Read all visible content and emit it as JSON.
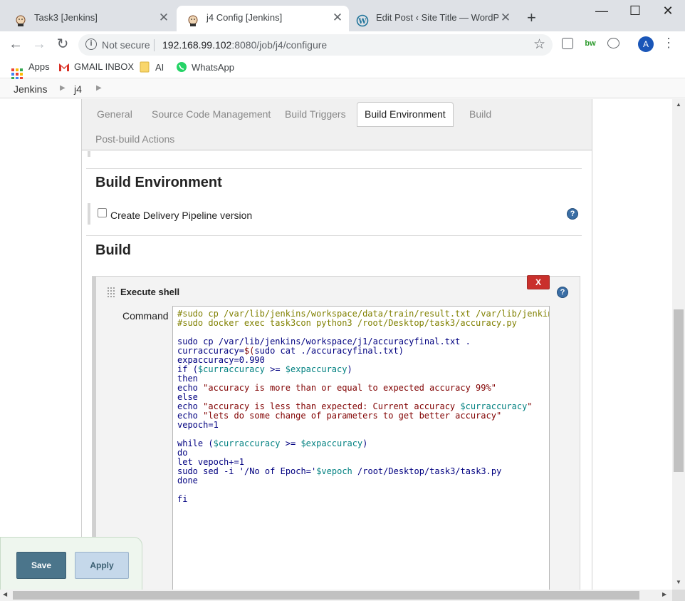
{
  "browser": {
    "tabs": [
      {
        "title": "Task3 [Jenkins]",
        "active": false
      },
      {
        "title": "j4 Config [Jenkins]",
        "active": true
      },
      {
        "title": "Edit Post ‹ Site Title — WordPres",
        "active": false
      }
    ],
    "close_glyph": "✕",
    "new_tab_glyph": "+",
    "window_controls": {
      "minimize": "—",
      "maximize": "☐",
      "close": "✕"
    },
    "security_label": "Not secure",
    "url_host": "192.168.99.102",
    "url_rest": ":8080/job/j4/configure",
    "profile_initial": "A",
    "extensions": [
      "bw"
    ],
    "bookmarks": [
      {
        "label": "Apps",
        "icon": "apps-grid-icon"
      },
      {
        "label": "GMAIL INBOX",
        "icon": "gmail-icon"
      },
      {
        "label": "AI",
        "icon": "folder-icon"
      },
      {
        "label": "WhatsApp",
        "icon": "whatsapp-icon"
      }
    ]
  },
  "breadcrumbs": [
    "Jenkins",
    "j4"
  ],
  "config_tabs": [
    {
      "label": "General",
      "active": false
    },
    {
      "label": "Source Code Management",
      "active": false
    },
    {
      "label": "Build Triggers",
      "active": false
    },
    {
      "label": "Build Environment",
      "active": true
    },
    {
      "label": "Build",
      "active": false
    },
    {
      "label": "Post-build Actions",
      "active": false
    }
  ],
  "build_environment": {
    "title": "Build Environment",
    "option_label": "Create Delivery Pipeline version",
    "option_checked": false
  },
  "build": {
    "title": "Build",
    "step": {
      "title": "Execute shell",
      "delete_label": "X",
      "command_label": "Command",
      "script_lines": [
        "#sudo cp /var/lib/jenkins/workspace/data/train/result.txt /var/lib/jenkin",
        "#sudo docker exec task3con python3 /root/Desktop/task3/accuracy.py",
        "",
        "sudo cp /var/lib/jenkins/workspace/j1/accuracyfinal.txt .",
        "curraccuracy=$(sudo cat ./accuracyfinal.txt)",
        "expaccuracy=0.990",
        "if ($curraccuracy >= $expaccuracy)",
        "then",
        "echo \"accuracy is more than or equal to expected accuracy 99%\"",
        "else",
        "echo \"accuracy is less than expected: Current accuracy $curraccuracy\"",
        "echo \"lets do some change of parameters to get better accuracy\"",
        "vepoch=1",
        "",
        "while ($curraccuracy >= $expaccuracy)",
        "do",
        "let vepoch+=1",
        "sudo sed -i '/No of Epoch='$vepoch /root/Desktop/task3/task3.py",
        "done",
        "",
        "fi"
      ]
    }
  },
  "actions": {
    "save_label": "Save",
    "apply_label": "Apply"
  },
  "help_glyph": "?",
  "colors": {
    "accent": "#4b758b",
    "delete": "#c9302c",
    "help": "#3a6ea5",
    "shell_keyword": "#000080",
    "shell_string": "#800000",
    "shell_variable": "#008080",
    "shell_comment": "#808000"
  }
}
